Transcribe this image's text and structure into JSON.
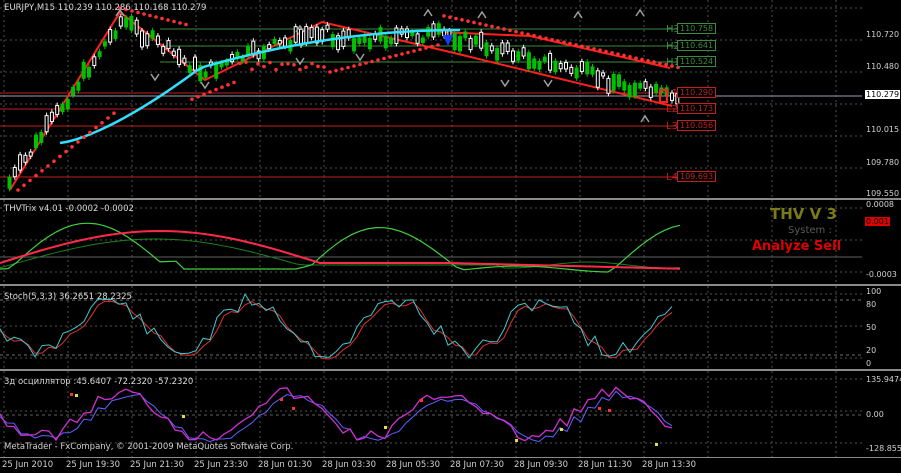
{
  "main": {
    "symbol_info": "EURJPY,M15 110.239 110.286 110.168 110.279",
    "price_axis": [
      "110.720",
      "110.480",
      "110.279",
      "110.015",
      "109.780",
      "109.550"
    ],
    "current_price": "110.279",
    "levels": [
      {
        "name": "H3",
        "value": "110.758",
        "color": "#3c8c3c"
      },
      {
        "name": "H2",
        "value": "110.641",
        "color": "#3c8c3c"
      },
      {
        "name": "H1",
        "value": "110.524",
        "color": "#3c8c3c"
      },
      {
        "name": "L1",
        "value": "110.290",
        "color": "#c02020"
      },
      {
        "name": "L2",
        "value": "110.173",
        "color": "#c02020"
      },
      {
        "name": "L3",
        "value": "110.056",
        "color": "#c02020"
      },
      {
        "name": "L4",
        "value": "109.693",
        "color": "#c02020"
      }
    ]
  },
  "thv": {
    "label": "THVTrix v4.01 -0.0002 -0.0002",
    "axis": [
      "0.0008",
      "0.001",
      "-0.0003"
    ],
    "title": "THV V 3",
    "system": "System :",
    "signal": "Analyze Sell"
  },
  "stoch": {
    "label": "Stoch(5,3,3) 36.2651 28.2325",
    "axis": [
      "100",
      "80",
      "50",
      "20",
      "0"
    ]
  },
  "osc": {
    "label": "3д осциллятор :45.6407 -72.2320 -57.2320",
    "axis": [
      "135.9474",
      "0.00",
      "-128.8550"
    ],
    "copyright": "MetaTrader - FxCompany, © 2001-2009 MetaQuotes Software Corp."
  },
  "time_axis": [
    "25 Jun 2010",
    "25 Jun 19:30",
    "25 Jun 21:30",
    "25 Jun 23:30",
    "28 Jun 01:30",
    "28 Jun 03:30",
    "28 Jun 05:30",
    "28 Jun 07:30",
    "28 Jun 09:30",
    "28 Jun 11:30",
    "28 Jun 13:30"
  ],
  "colors": {
    "up": "#ffffff",
    "down": "#00c000",
    "sar": "#ff3030",
    "ma": "#30e0ff",
    "grid": "#505050"
  }
}
